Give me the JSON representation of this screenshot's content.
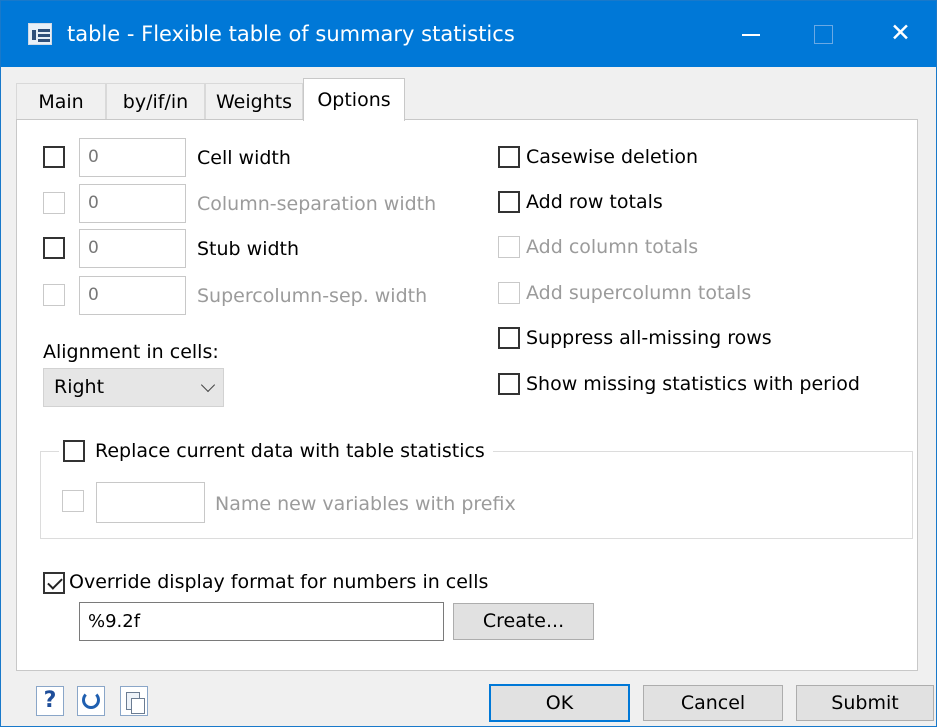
{
  "window": {
    "title": "table - Flexible table of summary statistics",
    "icons": {
      "app": "table-dialog-icon",
      "minimize": "minimize-icon",
      "maximize": "maximize-icon",
      "close": "close-icon"
    },
    "close_glyph": "✕"
  },
  "tabs": [
    {
      "label": "Main",
      "active": false
    },
    {
      "label": "by/if/in",
      "active": false
    },
    {
      "label": "Weights",
      "active": false
    },
    {
      "label": "Options",
      "active": true
    }
  ],
  "width_options": [
    {
      "label": "Cell width",
      "value": "0",
      "checked": false,
      "enabled": true
    },
    {
      "label": "Column-separation width",
      "value": "0",
      "checked": false,
      "enabled": false
    },
    {
      "label": "Stub width",
      "value": "0",
      "checked": false,
      "enabled": true
    },
    {
      "label": "Supercolumn-sep. width",
      "value": "0",
      "checked": false,
      "enabled": false
    }
  ],
  "alignment": {
    "label": "Alignment in cells:",
    "selected": "Right"
  },
  "right_options": [
    {
      "label": "Casewise deletion",
      "checked": false,
      "enabled": true
    },
    {
      "label": "Add row totals",
      "checked": false,
      "enabled": true
    },
    {
      "label": "Add column totals",
      "checked": false,
      "enabled": false
    },
    {
      "label": "Add supercolumn totals",
      "checked": false,
      "enabled": false
    },
    {
      "label": "Suppress all-missing rows",
      "checked": false,
      "enabled": true
    },
    {
      "label": "Show missing statistics with period",
      "checked": false,
      "enabled": true
    }
  ],
  "replace": {
    "label": "Replace current data with table statistics",
    "checked": false,
    "prefix_label": "Name new variables with prefix",
    "prefix_value": "",
    "prefix_enabled": false
  },
  "format": {
    "label": "Override display format for numbers in cells",
    "checked": true,
    "value": "%9.2f",
    "create_label": "Create..."
  },
  "footer": {
    "help_glyph": "?",
    "ok": "OK",
    "cancel": "Cancel",
    "submit": "Submit"
  },
  "colors": {
    "accent": "#0078d7",
    "disabled_text": "#9b9b9b"
  }
}
